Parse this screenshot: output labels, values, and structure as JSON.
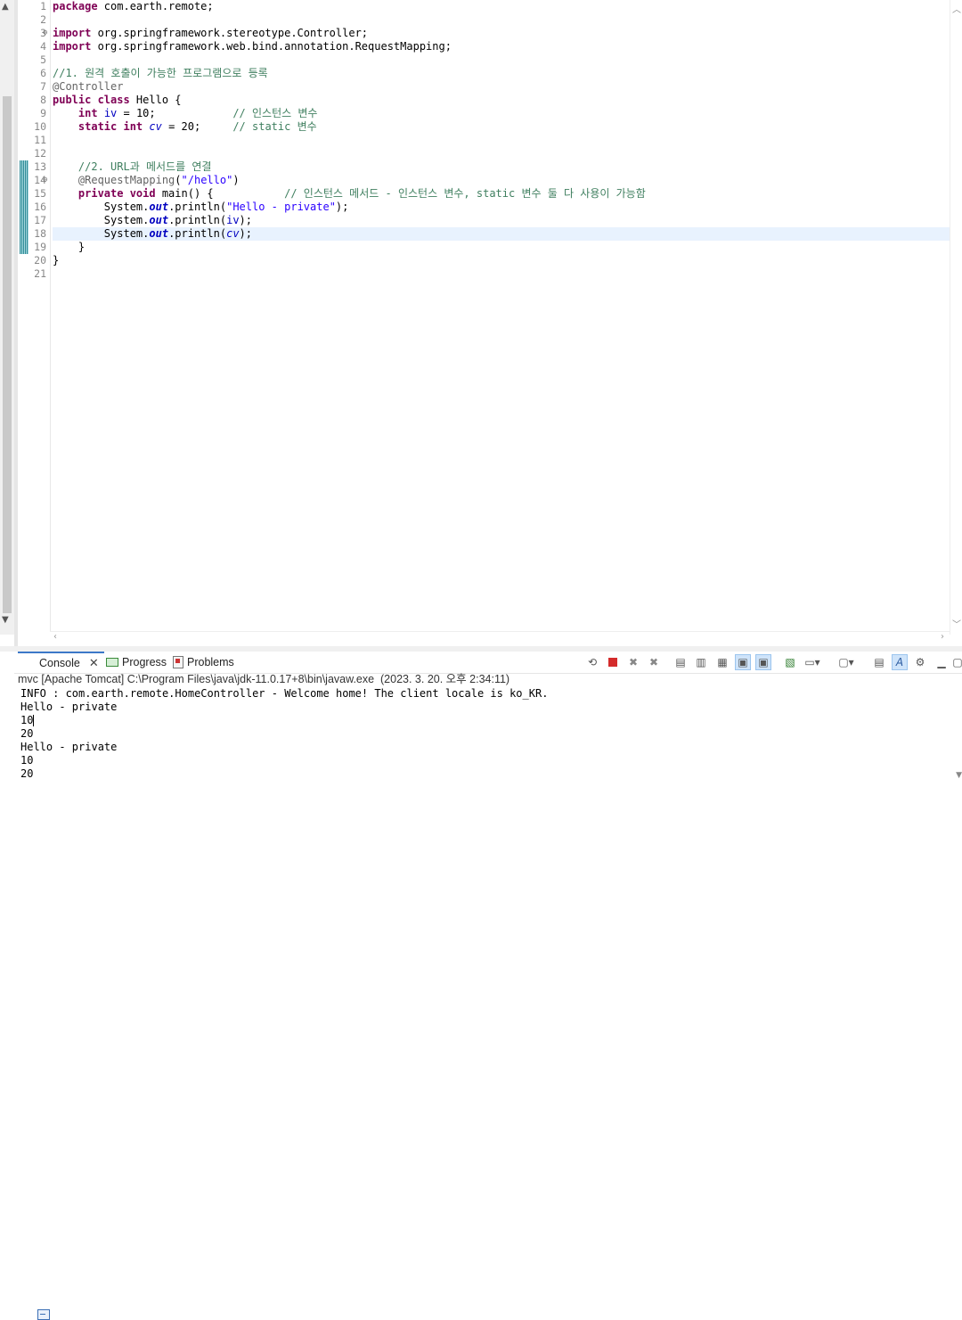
{
  "editor": {
    "lines": [
      {
        "n": "1",
        "html": "<span class=\"kw\">package</span> com.earth.remote;"
      },
      {
        "n": "2",
        "html": ""
      },
      {
        "n": "3",
        "fold": true,
        "html": "<span class=\"kw\">import</span> org.springframework.stereotype.Controller;"
      },
      {
        "n": "4",
        "html": "<span class=\"kw\">import</span> org.springframework.web.bind.annotation.RequestMapping;"
      },
      {
        "n": "5",
        "html": ""
      },
      {
        "n": "6",
        "html": "<span class=\"cm\">//1. 원격 호출이 가능한 프로그램으로 등록</span>"
      },
      {
        "n": "7",
        "html": "<span class=\"an\">@Controller</span>"
      },
      {
        "n": "8",
        "html": "<span class=\"kw\">public class</span> Hello {"
      },
      {
        "n": "9",
        "html": "    <span class=\"kw\">int</span> <span class=\"fi\">iv</span> = 10;            <span class=\"cm\">// 인스턴스 변수</span>"
      },
      {
        "n": "10",
        "html": "    <span class=\"kw\">static int</span> <span class=\"sfv\">cv</span> = 20;     <span class=\"cm\">// static 변수</span>"
      },
      {
        "n": "11",
        "html": ""
      },
      {
        "n": "12",
        "html": ""
      },
      {
        "n": "13",
        "html": "    <span class=\"cm\">//2. URL과 메서드를 연결</span>"
      },
      {
        "n": "14",
        "fold": true,
        "html": "    <span class=\"an\">@RequestMapping</span>(<span class=\"st\">\"/hello\"</span>)"
      },
      {
        "n": "15",
        "html": "    <span class=\"kw\">private void</span> main() {           <span class=\"cm\">// 인스턴스 메서드 - 인스턴스 변수, static 변수 둘 다 사용이 가능함</span>"
      },
      {
        "n": "16",
        "html": "        System.<span class=\"sf\">out</span>.println(<span class=\"st\">\"Hello - private\"</span>);"
      },
      {
        "n": "17",
        "html": "        System.<span class=\"sf\">out</span>.println(<span class=\"fi\">iv</span>);"
      },
      {
        "n": "18",
        "current": true,
        "html": "        System.<span class=\"sf\">out</span>.println(<span class=\"sfv\">cv</span>);"
      },
      {
        "n": "19",
        "html": "    }"
      },
      {
        "n": "20",
        "html": "}"
      },
      {
        "n": "21",
        "html": ""
      }
    ]
  },
  "console": {
    "tabs": {
      "console": "Console",
      "progress": "Progress",
      "problems": "Problems"
    },
    "process": "mvc [Apache Tomcat] C:\\Program Files\\java\\jdk-11.0.17+8\\bin\\javaw.exe  (2023. 3. 20. 오후 2:34:11)",
    "output": [
      "INFO : com.earth.remote.HomeController - Welcome home! The client locale is ko_KR.",
      "Hello - private",
      "10",
      "20",
      "Hello - private",
      "10",
      "20"
    ]
  },
  "icons": {
    "pin": "pin-icon",
    "terminate": "terminate-icon",
    "remove-launch": "remove-launch-icon",
    "remove-all": "remove-all-icon",
    "clear-console": "clear-console-icon",
    "scroll-lock": "scroll-lock-icon",
    "word-wrap": "word-wrap-icon",
    "show-stdout": "show-stdout-icon",
    "show-stderr": "show-stderr-icon",
    "pin-console": "pin-console-icon",
    "display-console": "display-console-icon",
    "open-console": "open-console-icon",
    "copy": "copy-icon",
    "highlight": "highlight-icon",
    "settings": "settings-icon",
    "minimize": "minimize-icon",
    "maximize": "maximize-icon"
  },
  "colors": {
    "keyword": "#7f0055",
    "comment": "#3f7f5f",
    "string": "#2a00ff",
    "field": "#0000c0",
    "annotation": "#646464",
    "current_line": "#e8f2fe",
    "active_tab_border": "#3c78c8"
  }
}
